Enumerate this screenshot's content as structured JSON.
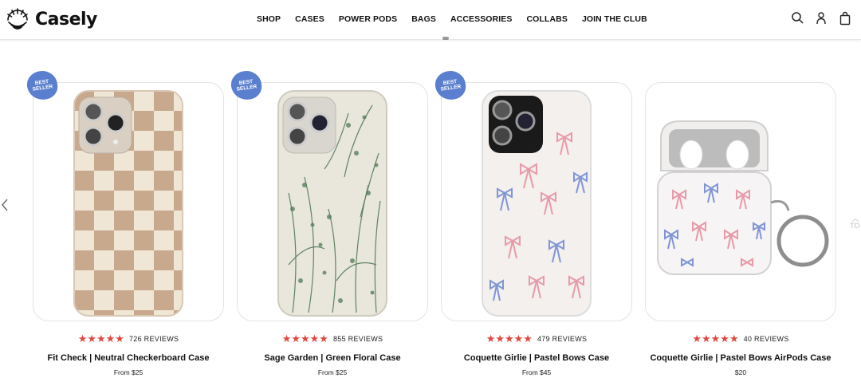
{
  "brand": {
    "name": "Casely"
  },
  "nav": {
    "items": [
      "SHOP",
      "CASES",
      "POWER PODS",
      "BAGS",
      "ACCESSORIES",
      "COLLABS",
      "JOIN THE CLUB"
    ]
  },
  "header_icons": [
    "search-icon",
    "account-icon",
    "bag-icon"
  ],
  "side_label": "TO",
  "colors": {
    "star": "#e0473f",
    "badge": "#5b7fcf"
  },
  "products": [
    {
      "badge_line1": "BEST",
      "badge_line2": "SELLER",
      "stars": "★★★★★",
      "rating": 5,
      "reviews": "726 REVIEWS",
      "name": "Fit Check | Neutral Checkerboard Case",
      "price": "From $25"
    },
    {
      "badge_line1": "BEST",
      "badge_line2": "SELLER",
      "stars": "★★★★★",
      "rating": 5,
      "reviews": "855 REVIEWS",
      "name": "Sage Garden | Green Floral Case",
      "price": "From $25"
    },
    {
      "badge_line1": "BEST",
      "badge_line2": "SELLER",
      "stars": "★★★★★",
      "rating": 5,
      "reviews": "479 REVIEWS",
      "name": "Coquette Girlie | Pastel Bows Case",
      "price": "From $45"
    },
    {
      "stars": "★★★★★",
      "rating": 5,
      "reviews": "40 REVIEWS",
      "name": "Coquette Girlie | Pastel Bows AirPods Case",
      "price": "$20"
    }
  ]
}
